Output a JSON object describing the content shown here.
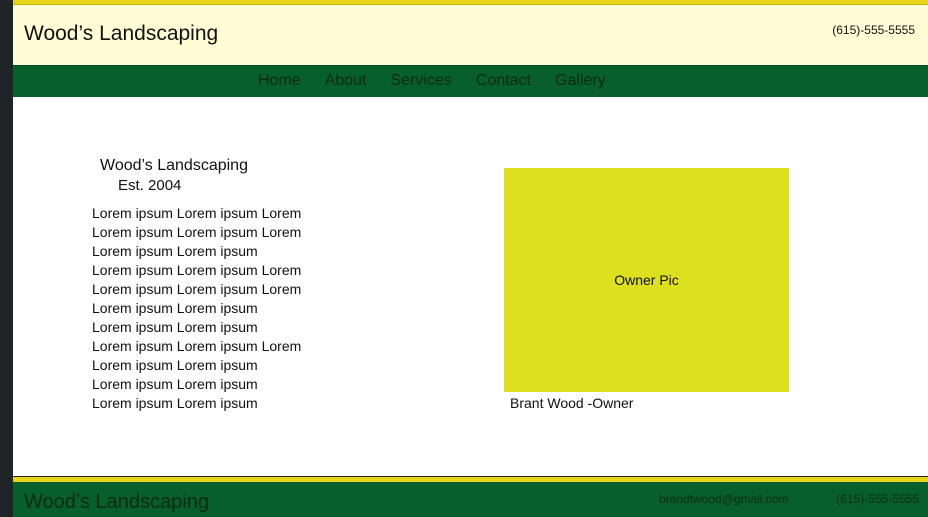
{
  "header": {
    "title": "Wood’s Landscaping",
    "phone": "(615)-555-5555"
  },
  "nav": {
    "items": [
      {
        "label": "Home"
      },
      {
        "label": "About"
      },
      {
        "label": "Services"
      },
      {
        "label": "Contact"
      },
      {
        "label": "Gallery"
      }
    ]
  },
  "about": {
    "title": "Wood’s Landscaping",
    "established": "Est. 2004",
    "lines": [
      "Lorem ipsum Lorem ipsum Lorem",
      "Lorem ipsum Lorem ipsum Lorem",
      "Lorem ipsum Lorem ipsum",
      "Lorem ipsum Lorem ipsum Lorem",
      "Lorem ipsum Lorem ipsum Lorem",
      "Lorem ipsum Lorem ipsum",
      "Lorem ipsum Lorem ipsum",
      "Lorem ipsum Lorem ipsum Lorem",
      "Lorem ipsum Lorem ipsum",
      "Lorem ipsum Lorem ipsum",
      "Lorem ipsum Lorem ipsum"
    ]
  },
  "owner": {
    "pic_label": "Owner Pic",
    "caption": "Brant Wood -Owner"
  },
  "footer": {
    "title": "Wood’s Landscaping",
    "email": "brandtwood@gmail.com",
    "phone": "(615)-555-5555"
  },
  "colors": {
    "header_bg": "#fffdd6",
    "accent_yellow": "#e8d51a",
    "nav_green": "#07602c",
    "owner_pic_bg": "#dce01f"
  }
}
